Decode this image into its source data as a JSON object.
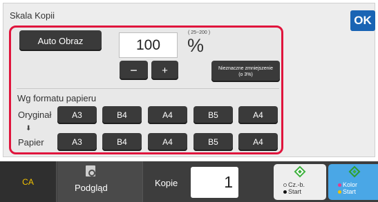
{
  "header": {
    "title": "Skala Kopii",
    "ok_label": "OK"
  },
  "auto_button": {
    "label": "Auto Obraz"
  },
  "ratio": {
    "value": "100",
    "range": "( 25~200 )",
    "unit": "%"
  },
  "adjust": {
    "minus_label": "−",
    "plus_label": "+"
  },
  "slight_reduce": {
    "line1": "Nieznaczne zmniejszenie",
    "line2": "(o 3%)"
  },
  "paper_section": {
    "title": "Wg formatu papieru",
    "original_label": "Oryginał",
    "arrow": "⬇",
    "paper_label": "Papier",
    "original_sizes": [
      "A3",
      "B4",
      "A4",
      "B5",
      "A4"
    ],
    "paper_sizes": [
      "A3",
      "B4",
      "A4",
      "B5",
      "A4"
    ]
  },
  "bottom": {
    "ca_label": "CA",
    "preview_label": "Podgląd",
    "copies_label": "Kopie",
    "copies_value": "1",
    "start_bw_line1": "Cz.-b.",
    "start_bw_line2": "Start",
    "start_color_line1": "Kolor",
    "start_color_line2": "Start"
  },
  "colors": {
    "accent_frame": "#e0143c",
    "ok_button": "#1a64b4",
    "ca_text": "#f2c200",
    "color_start": "#4aa7e6"
  }
}
